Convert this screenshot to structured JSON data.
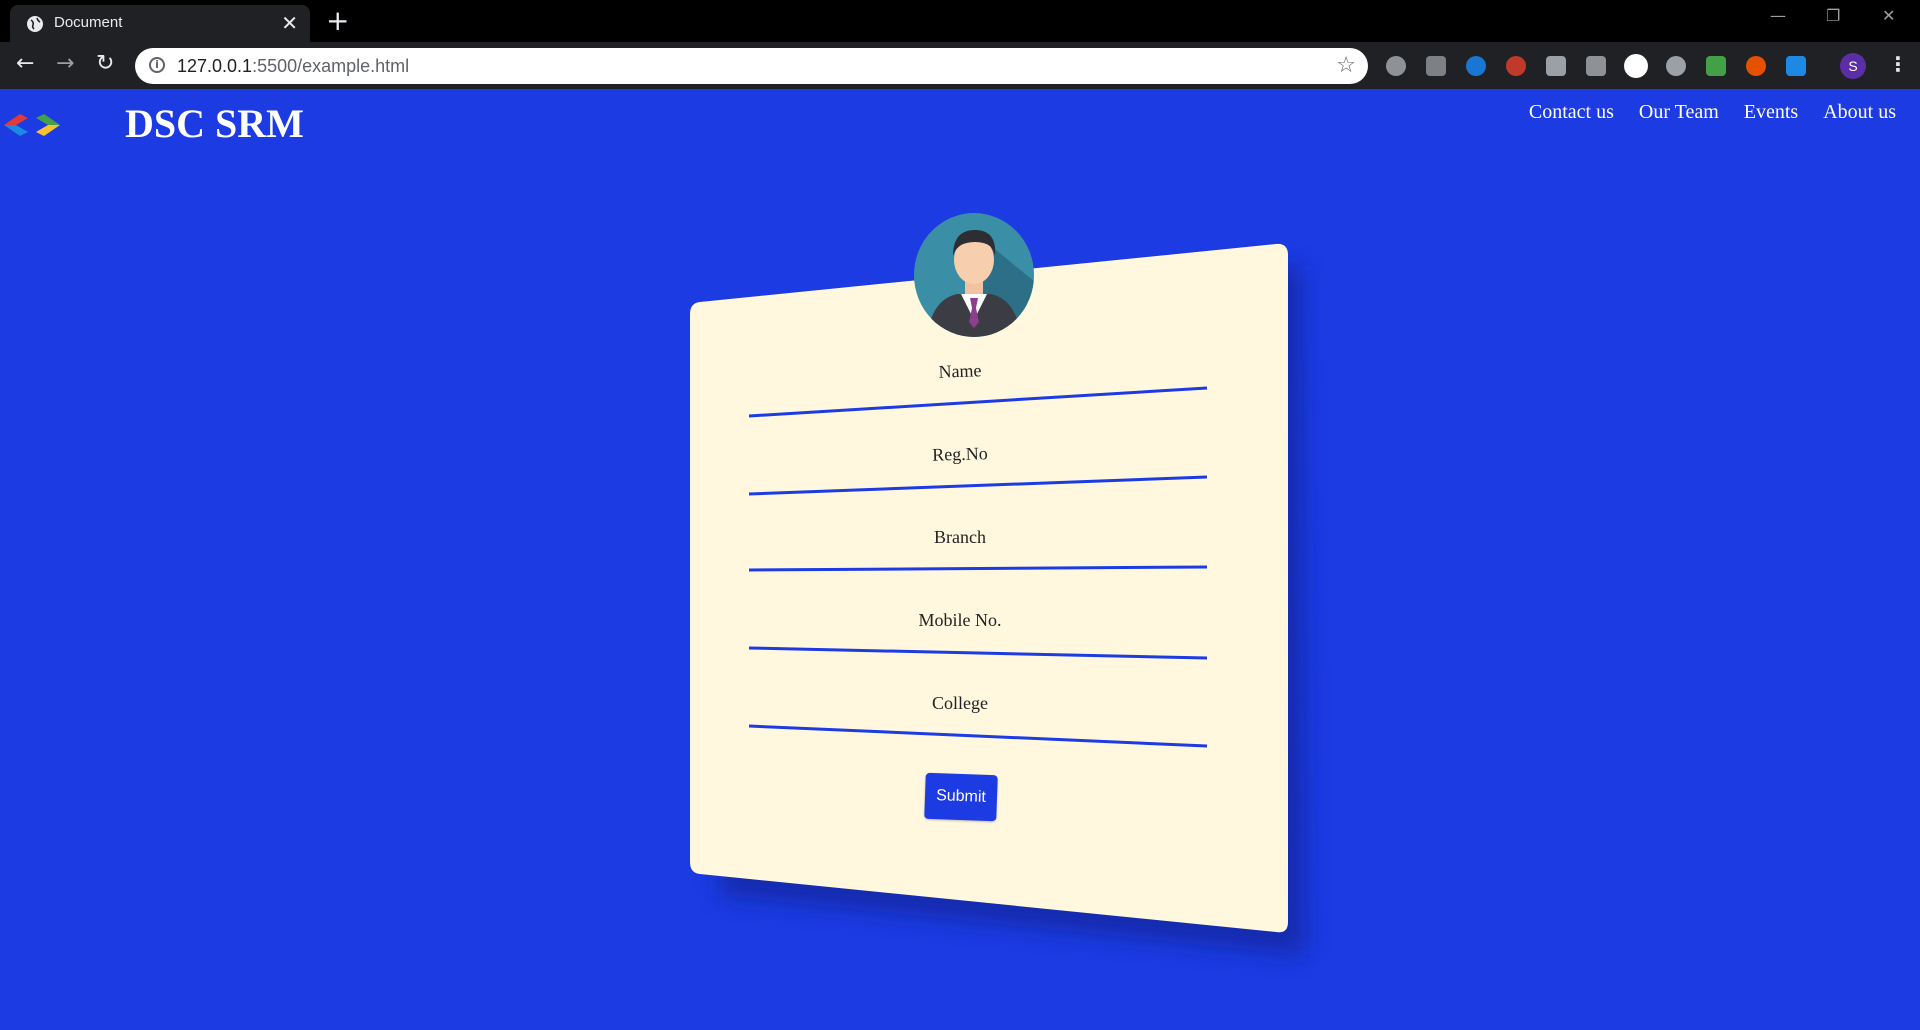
{
  "browser": {
    "tab_title": "Document",
    "tab_close": "✕",
    "new_tab": "+",
    "url_host": "127.0.0.1",
    "url_path": ":5500/example.html",
    "profile_initial": "S",
    "icons": [
      "globe-icon",
      "back-icon",
      "forward-icon",
      "reload-icon",
      "info-icon",
      "star-icon",
      "extension-icons",
      "menu-icon"
    ]
  },
  "header": {
    "brand": "DSC SRM",
    "nav": [
      "Contact us",
      "Our Team",
      "Events",
      "About us"
    ]
  },
  "form": {
    "fields": [
      {
        "label": "Name"
      },
      {
        "label": "Reg.No"
      },
      {
        "label": "Branch"
      },
      {
        "label": "Mobile No."
      },
      {
        "label": "College"
      }
    ],
    "submit_label": "Submit"
  },
  "colors": {
    "page_bg": "#1c3be3",
    "card_bg": "#fff8df",
    "line": "#1c3be3"
  }
}
